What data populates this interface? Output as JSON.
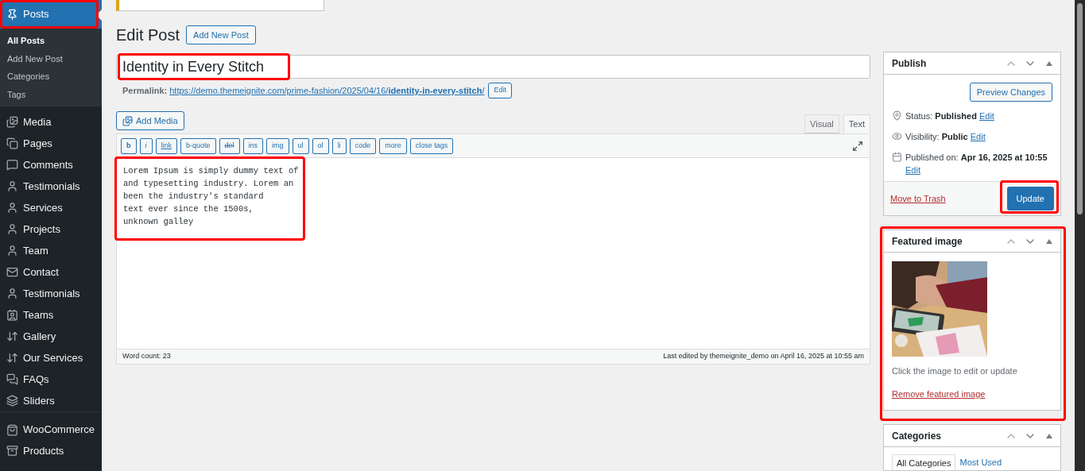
{
  "sidebar": {
    "items": [
      {
        "label": "Posts",
        "selected": true,
        "highlighted": true,
        "children": [
          {
            "label": "All Posts",
            "selected": true
          },
          {
            "label": "Add New Post",
            "selected": false
          },
          {
            "label": "Categories",
            "selected": false
          },
          {
            "label": "Tags",
            "selected": false
          }
        ]
      },
      {
        "label": "Media",
        "selected": false
      },
      {
        "label": "Pages",
        "selected": false
      },
      {
        "label": "Comments",
        "selected": false
      },
      {
        "label": "Testimonials",
        "selected": false
      },
      {
        "label": "Services",
        "selected": false
      },
      {
        "label": "Projects",
        "selected": false
      },
      {
        "label": "Team",
        "selected": false
      },
      {
        "label": "Contact",
        "selected": false
      },
      {
        "label": "Testimonials",
        "selected": false
      },
      {
        "label": "Teams",
        "selected": false
      },
      {
        "label": "Gallery",
        "selected": false
      },
      {
        "label": "Our Services",
        "selected": false
      },
      {
        "label": "FAQs",
        "selected": false
      },
      {
        "label": "Sliders",
        "selected": false
      },
      {
        "label": "WooCommerce",
        "selected": false,
        "separator_before": true
      },
      {
        "label": "Products",
        "selected": false
      }
    ]
  },
  "heading": "Edit Post",
  "add_new_button": "Add New Post",
  "title_field": {
    "value": "Identity in Every Stitch",
    "highlighted": true
  },
  "permalink": {
    "label": "Permalink:",
    "url": "https://demo.themeignite.com/prime-fashion/2025/04/16/**identity-in-every-stitch**/",
    "edit_button": "Edit"
  },
  "editor": {
    "add_media": "Add Media",
    "tabs": [
      {
        "label": "Visual",
        "selected": false
      },
      {
        "label": "Text",
        "selected": true
      }
    ],
    "quicktags": [
      "b",
      "i",
      "link",
      "b-quote",
      "del",
      "ins",
      "img",
      "ul",
      "ol",
      "li",
      "code",
      "more",
      "close tags"
    ],
    "content": {
      "lines": [
        "Lorem Ipsum is simply dummy text of",
        "and typesetting industry. Lorem an",
        "been the industry's standard",
        "text ever since the 1500s,",
        "unknown galley"
      ],
      "highlighted": true
    },
    "word_count": "Word count: 23",
    "last_edited": "Last edited by themeignite_demo on April 16, 2025 at 10:55 am"
  },
  "publish": {
    "title": "Publish",
    "preview_button": "Preview Changes",
    "rows": [
      {
        "label": "Status:",
        "value": "Published",
        "edit": "Edit"
      },
      {
        "label": "Visibility:",
        "value": "Public",
        "edit": "Edit"
      },
      {
        "label": "Published on:",
        "value": "Apr 16, 2025 at 10:55",
        "edit": "Edit"
      }
    ],
    "trash_link": "Move to Trash",
    "update_button": "Update",
    "update_highlighted": true
  },
  "featured_image": {
    "title": "Featured image",
    "highlighted": true,
    "hint": "Click the image to edit or update",
    "remove_link": "Remove featured image"
  },
  "categories": {
    "title": "Categories",
    "tabs": [
      {
        "label": "All Categories",
        "selected": true
      },
      {
        "label": "Most Used",
        "selected": false
      }
    ]
  }
}
